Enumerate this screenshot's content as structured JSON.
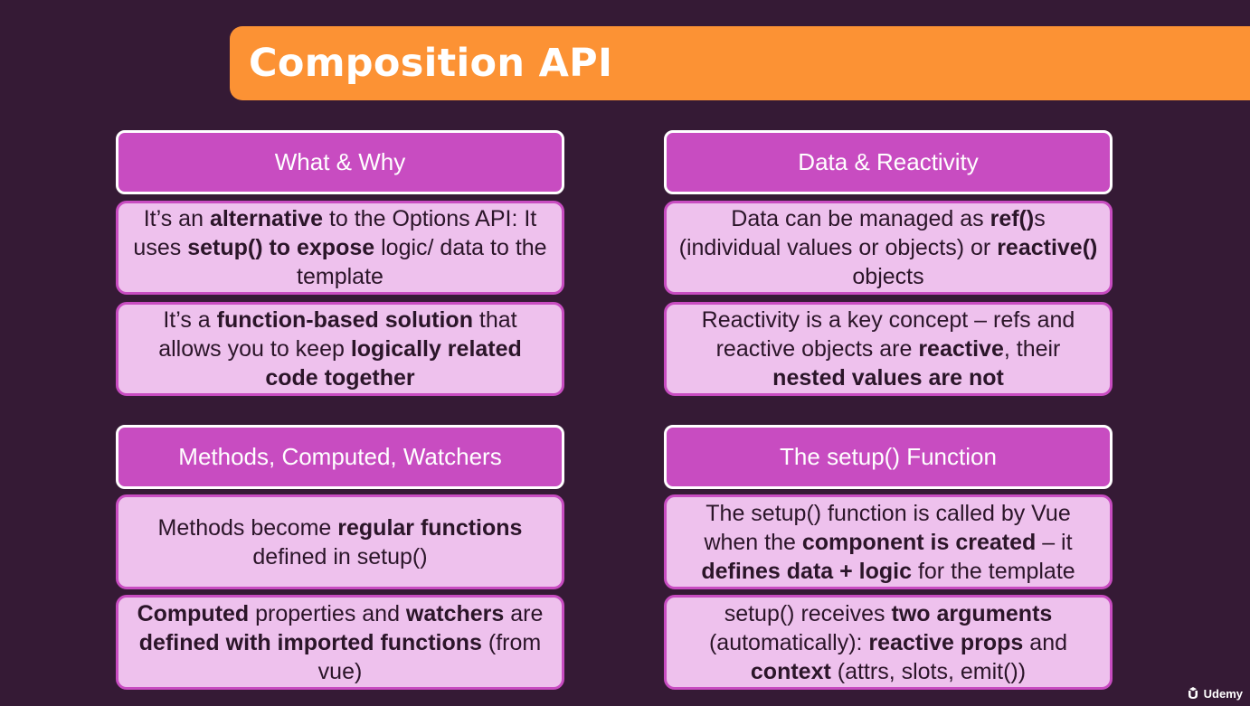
{
  "title": "Composition API",
  "sections": [
    {
      "heading": "What & Why",
      "boxes": [
        [
          {
            "t": "It’s an "
          },
          {
            "t": "alternative",
            "b": true
          },
          {
            "t": " to the Options API: It uses "
          },
          {
            "t": "setup() to expose",
            "b": true
          },
          {
            "t": " logic/ data to the template"
          }
        ],
        [
          {
            "t": "It’s a "
          },
          {
            "t": "function-based solution",
            "b": true
          },
          {
            "t": " that allows you to keep "
          },
          {
            "t": "logically related code together",
            "b": true
          }
        ]
      ]
    },
    {
      "heading": "Data & Reactivity",
      "boxes": [
        [
          {
            "t": "Data can be managed as "
          },
          {
            "t": "ref()",
            "b": true
          },
          {
            "t": "s (individual values or objects) or "
          },
          {
            "t": "reactive()",
            "b": true
          },
          {
            "t": " objects"
          }
        ],
        [
          {
            "t": "Reactivity is a key concept – refs and reactive objects are "
          },
          {
            "t": "reactive",
            "b": true
          },
          {
            "t": ", their "
          },
          {
            "t": "nested values are not",
            "b": true
          }
        ]
      ]
    },
    {
      "heading": "Methods, Computed, Watchers",
      "boxes": [
        [
          {
            "t": "Methods become "
          },
          {
            "t": "regular functions",
            "b": true
          },
          {
            "t": " defined in setup()"
          }
        ],
        [
          {
            "t": "Computed",
            "b": true
          },
          {
            "t": " properties and "
          },
          {
            "t": "watchers",
            "b": true
          },
          {
            "t": " are "
          },
          {
            "t": "defined with imported functions",
            "b": true
          },
          {
            "t": " (from vue)"
          }
        ]
      ]
    },
    {
      "heading": "The setup() Function",
      "boxes": [
        [
          {
            "t": "The setup() function is called by Vue when the "
          },
          {
            "t": "component is created",
            "b": true
          },
          {
            "t": " – it "
          },
          {
            "t": "defines data + logic",
            "b": true
          },
          {
            "t": " for the template"
          }
        ],
        [
          {
            "t": "setup() receives "
          },
          {
            "t": "two arguments",
            "b": true
          },
          {
            "t": " (automatically): "
          },
          {
            "t": "reactive props",
            "b": true
          },
          {
            "t": " and "
          },
          {
            "t": "context",
            "b": true
          },
          {
            "t": " (attrs, slots, emit())"
          }
        ]
      ]
    }
  ],
  "watermark": {
    "label": "Udemy",
    "icon": "udemy-logo-icon"
  },
  "colors": {
    "background": "#351a35",
    "title_bar": "#fc9234",
    "header_fill": "#c84cc1",
    "content_fill": "#eec1ed",
    "text_dark": "#2b1529"
  }
}
